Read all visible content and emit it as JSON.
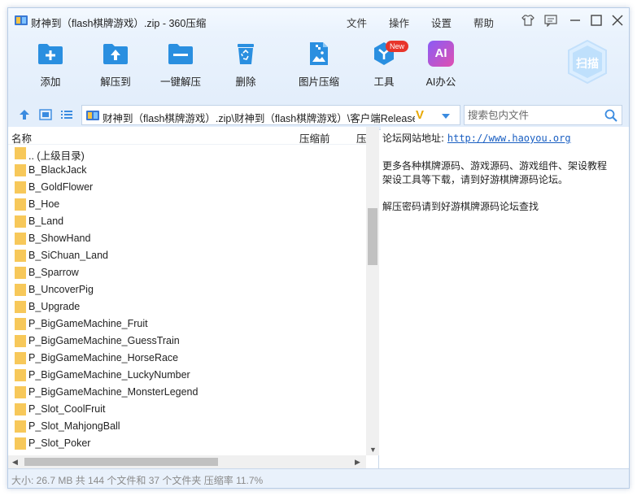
{
  "window": {
    "title": "财神到（flash棋牌游戏）.zip - 360压缩"
  },
  "menu": [
    "文件",
    "操作",
    "设置",
    "帮助"
  ],
  "toolbar": [
    {
      "label": "添加",
      "icon": "add-icon"
    },
    {
      "label": "解压到",
      "icon": "extract-to-icon"
    },
    {
      "label": "一键解压",
      "icon": "one-click-extract-icon"
    },
    {
      "label": "删除",
      "icon": "recycle-bin-icon"
    },
    {
      "label": "图片压缩",
      "icon": "image-compress-icon"
    },
    {
      "label": "工具",
      "icon": "tools-icon",
      "badge": "New"
    },
    {
      "label": "AI办公",
      "icon": "ai-office-icon",
      "glyph": "AI"
    }
  ],
  "scan": {
    "label": "扫描"
  },
  "address": {
    "path": "财神到（flash棋牌游戏）.zip\\财神到（flash棋牌游戏）\\客户端Release\\G",
    "v_mark": "V"
  },
  "search": {
    "placeholder": "搜索包内文件"
  },
  "columns": [
    "名称",
    "压缩前",
    "压"
  ],
  "files": [
    ".. (上级目录)",
    "B_BlackJack",
    "B_GoldFlower",
    "B_Hoe",
    "B_Land",
    "B_ShowHand",
    "B_SiChuan_Land",
    "B_Sparrow",
    "B_UncoverPig",
    "B_Upgrade",
    "P_BigGameMachine_Fruit",
    "P_BigGameMachine_GuessTrain",
    "P_BigGameMachine_HorseRace",
    "P_BigGameMachine_LuckyNumber",
    "P_BigGameMachine_MonsterLegend",
    "P_Slot_CoolFruit",
    "P_Slot_MahjongBall",
    "P_Slot_Poker"
  ],
  "comment": {
    "site_label": "论坛网站地址:",
    "site_url": "http://www.haoyou.org",
    "line1": "更多各种棋牌源码、游戏源码、游戏组件、架设教程",
    "line2": "架设工具等下载，请到好游棋牌源码论坛。",
    "line3": "解压密码请到好游棋牌源码论坛查找"
  },
  "status": "大小: 26.7 MB 共 144 个文件和 37 个文件夹 压缩率 11.7%",
  "colors": {
    "accent": "#2a8fe0",
    "folder": "#f7c85a",
    "badge": "#e8352b"
  }
}
